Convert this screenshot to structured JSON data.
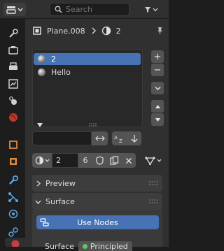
{
  "header": {
    "search_placeholder": "Search"
  },
  "breadcrumb": {
    "object_name": "Plane.008",
    "material_slot_name": "2"
  },
  "material_slots": [
    {
      "label": "2",
      "selected": true
    },
    {
      "label": "Hello",
      "selected": false
    }
  ],
  "material_selector": {
    "material_name": "2",
    "user_count": "6"
  },
  "panels": {
    "preview_label": "Preview",
    "surface_label": "Surface",
    "use_nodes_label": "Use Nodes",
    "surface_field_label": "Surface",
    "surface_field_value": "Principled"
  },
  "colors": {
    "accent": "#4772b3",
    "panel_bg": "#303030",
    "window_bg": "#1d1d1d"
  }
}
